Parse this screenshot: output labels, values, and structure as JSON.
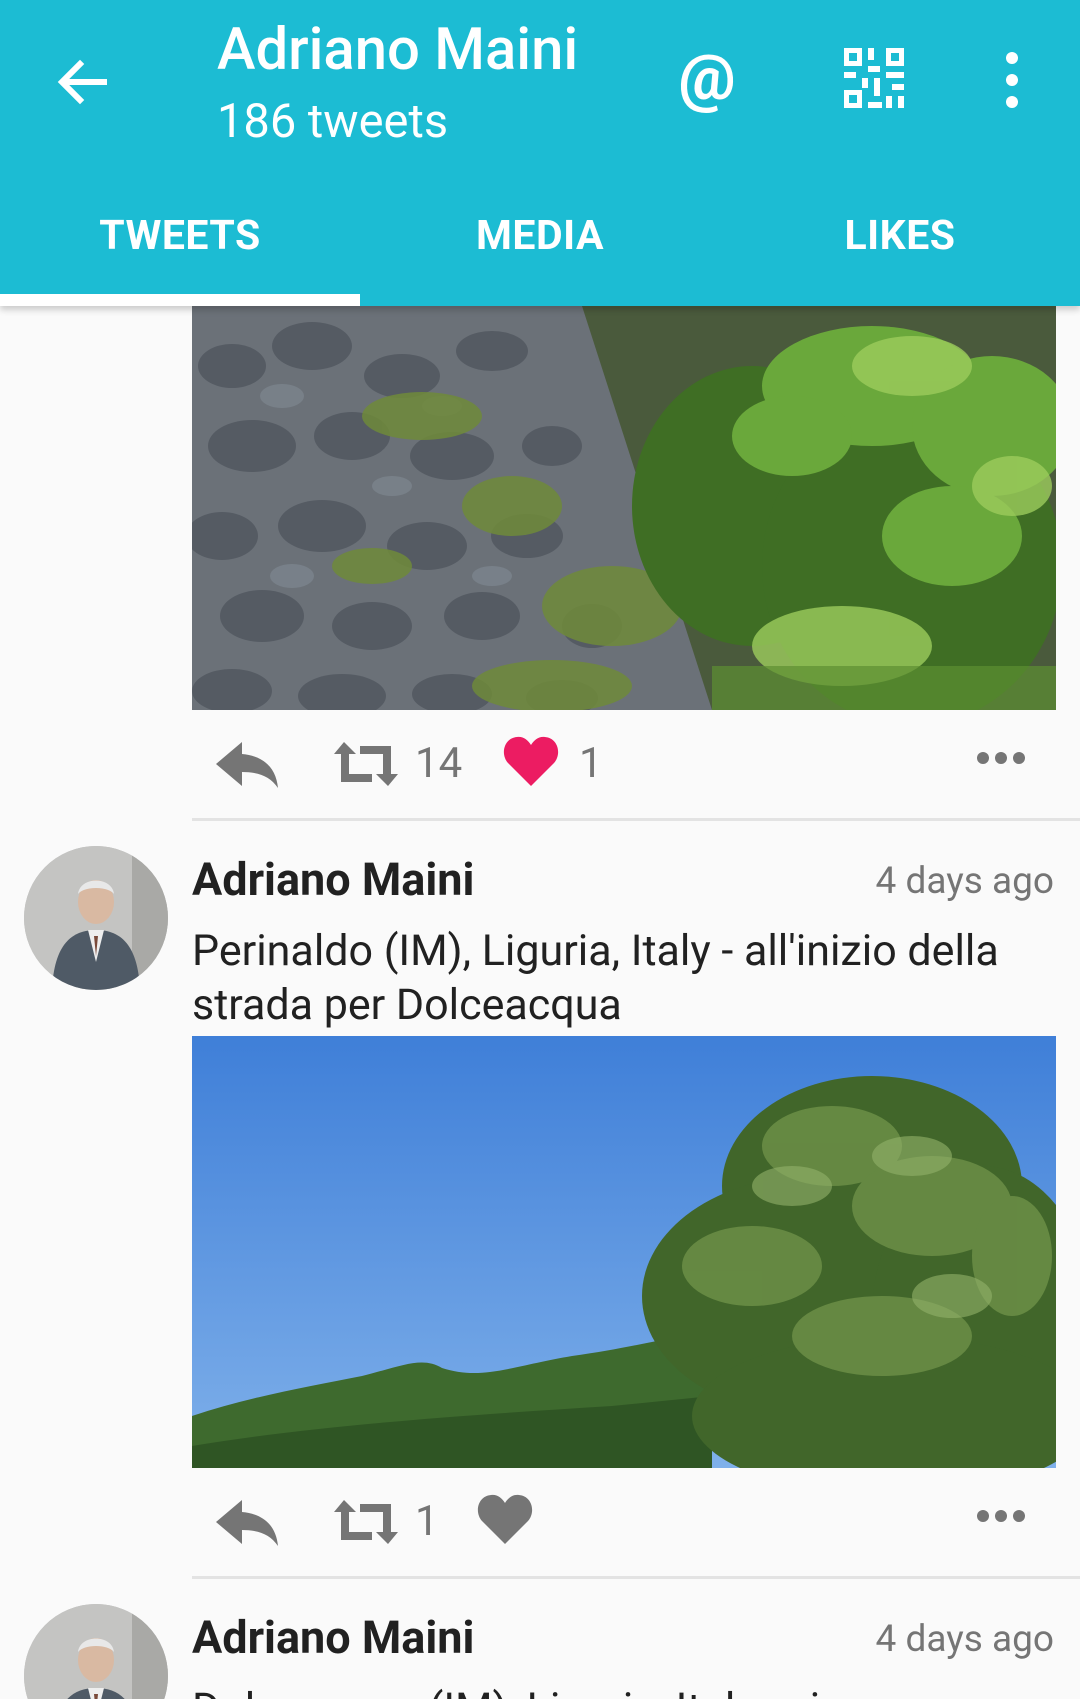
{
  "header": {
    "title": "Adriano Maini",
    "subtitle": "186 tweets",
    "mention_symbol": "@",
    "accent_color": "#1cbcd3",
    "icons": [
      "arrow-back-icon",
      "mention-icon",
      "qr-code-icon",
      "more-vert-icon"
    ]
  },
  "tabs": [
    {
      "label": "TWEETS",
      "selected": true
    },
    {
      "label": "MEDIA",
      "selected": false
    },
    {
      "label": "LIKES",
      "selected": false
    }
  ],
  "tweets": [
    {
      "photo": "photo-stone-wall-greenery",
      "retweets": "14",
      "likes": "1",
      "liked": true
    },
    {
      "author": "Adriano Maini",
      "time": "4 days ago",
      "text": "Perinaldo (IM), Liguria, Italy - all'inizio della strada per Dolceacqua",
      "photo": "photo-olive-tree-hills-sky",
      "retweets": "1",
      "likes": "",
      "liked": false
    },
    {
      "author": "Adriano Maini",
      "time": "4 days ago",
      "text": "Dolceacqua (IM), Liguria, Italy - via"
    }
  ],
  "colors": {
    "liked_heart": "#ec1c62",
    "icon_gray": "#757575"
  }
}
